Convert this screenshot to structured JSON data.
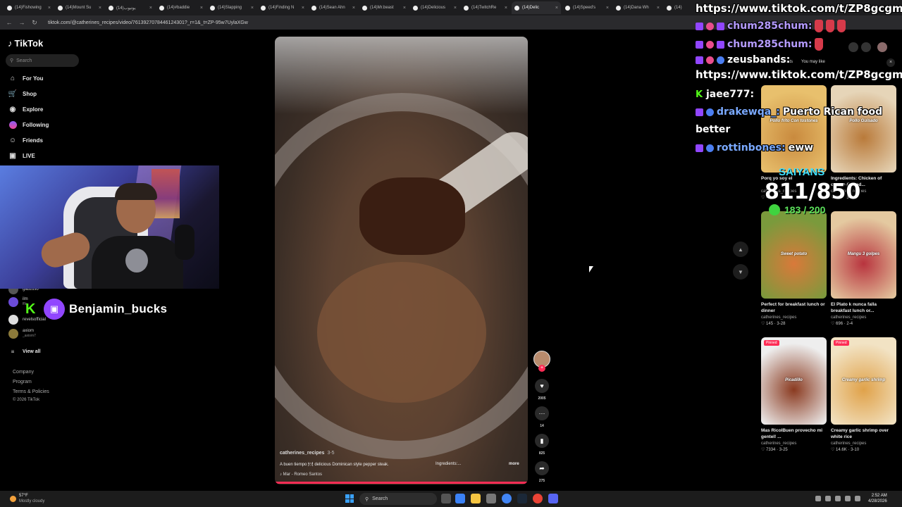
{
  "browser": {
    "tabs": [
      {
        "label": "(14)Fishowing",
        "active": false
      },
      {
        "label": "(14)Mount Su",
        "active": false
      },
      {
        "label": "(14)يوتيوب",
        "active": false
      },
      {
        "label": "(14)#baddie",
        "active": false
      },
      {
        "label": "(14)Slapping",
        "active": false
      },
      {
        "label": "(14)Finding N",
        "active": false
      },
      {
        "label": "(14)Sean Ahn",
        "active": false
      },
      {
        "label": "(14)Mr.beast",
        "active": false
      },
      {
        "label": "(14)Delicious",
        "active": false
      },
      {
        "label": "(14)TwitchRe",
        "active": false
      },
      {
        "label": "(14)Delic",
        "active": true
      },
      {
        "label": "(14)Speed's",
        "active": false
      },
      {
        "label": "(14)Dana Wh",
        "active": false
      },
      {
        "label": "(14)",
        "active": false
      }
    ],
    "url": "tiktok.com/@catherines_recipes/video/7613927078446124301?_r=1&_t=ZP-95w7UylaXGw"
  },
  "sidebar": {
    "logo": "TikTok",
    "search_placeholder": "Search",
    "nav": [
      {
        "label": "For You",
        "icon": "home-icon",
        "active": false
      },
      {
        "label": "Shop",
        "icon": "shop-icon",
        "active": false
      },
      {
        "label": "Explore",
        "icon": "compass-icon",
        "active": false
      },
      {
        "label": "Following",
        "icon": "following-icon",
        "active": false
      },
      {
        "label": "Friends",
        "icon": "friends-icon",
        "active": false
      },
      {
        "label": "LIVE",
        "icon": "live-icon",
        "active": false
      }
    ],
    "following": [
      {
        "name": "gabzuso",
        "handle": ""
      },
      {
        "name": "ilm",
        "handle": "fflo"
      },
      {
        "name": "revelsofficial",
        "handle": ""
      },
      {
        "name": "axiom",
        "handle": "_axiom7"
      }
    ],
    "view_all": "View all",
    "footer": [
      "Company",
      "Program",
      "Terms & Policies",
      "© 2026 TikTok"
    ]
  },
  "streamer": {
    "name": "Benjamin_bucks"
  },
  "video": {
    "author": "catherines_recipes",
    "date": "3-5",
    "description": "A buen tiempo 🍽 delicious Dominican style pepper steak.",
    "ingredients": "Ingredients:...",
    "more": "more",
    "music": "Mar - Romeo Santos",
    "likes": "2005",
    "comments": "14",
    "saves": "825",
    "shares": "275"
  },
  "recommendations": {
    "tabs": [
      "Comments",
      "You may like"
    ],
    "items": [
      {
        "caption": "Pollo frito Con tostones",
        "title": "Porq yo soy el",
        "author": "catherines_recipes",
        "likes": "",
        "date": "4-13",
        "pinned": false,
        "colors": [
          "#c98a3e",
          "#e8c06d"
        ]
      },
      {
        "caption": "Pollo Guisado",
        "title": "Ingredients: Chicken of choice (I used...",
        "author": "catherines_recipes",
        "likes": "320",
        "date": "3-1",
        "pinned": false,
        "colors": [
          "#b97a3a",
          "#e6d5b8"
        ]
      },
      {
        "caption": "Sweet potato",
        "title": "Perfect for breakfast lunch or dinner",
        "author": "catherines_recipes",
        "likes": "145",
        "date": "3-28",
        "pinned": false,
        "colors": [
          "#d9793a",
          "#7a9a3c"
        ]
      },
      {
        "caption": "Mangu 3 golpes",
        "title": "El Plato k nunca falla breakfast lunch or...",
        "author": "catherines_recipes",
        "likes": "696",
        "date": "2-4",
        "pinned": false,
        "colors": [
          "#b8343e",
          "#e4c9a0"
        ]
      },
      {
        "caption": "Picadillo",
        "title": "Mas RicolBuen provecho mi gentel! ...",
        "author": "catherines_recipes",
        "likes": "7334",
        "date": "3-25",
        "pinned": true,
        "colors": [
          "#8a3a20",
          "#eeeeee"
        ]
      },
      {
        "caption": "Creamy garlic shrimp",
        "title": "Creamy garlic shrimp over white rice",
        "author": "catherines_recipes",
        "likes": "14.6K",
        "date": "3-10",
        "pinned": true,
        "colors": [
          "#e0a24a",
          "#f2e3c4"
        ]
      }
    ],
    "pinned_label": "Pinned"
  },
  "chat": [
    {
      "user": "",
      "text": "https://www.tiktok.com/t/ZP8gcgmqo/",
      "color": "#ffffff"
    },
    {
      "user": "chum285chum:",
      "text": "",
      "color": "#b59bff"
    },
    {
      "user": "chum285chum:",
      "text": "",
      "color": "#b59bff"
    },
    {
      "user": "zeusbands:",
      "text": "",
      "color": "#ffffff"
    },
    {
      "user": "",
      "text": "https://www.tiktok.com/t/ZP8gcgmqo/",
      "color": "#ffffff"
    },
    {
      "user": "jaee777:",
      "text": "",
      "color": "#9bff6a"
    },
    {
      "user": "drakewqa_:",
      "text": "Puerto Rican food",
      "color": "#7aa9ff"
    },
    {
      "user": "",
      "text": "better",
      "color": "#ffffff"
    },
    {
      "user": "rottinbones:",
      "text": "eww",
      "color": "#7aa9ff"
    }
  ],
  "goals": {
    "label": "SAIYANS",
    "main": "811/850",
    "sub": "183 / 200"
  },
  "taskbar": {
    "temp": "57°F",
    "weather": "Mostly cloudy",
    "search": "Search",
    "time": "2:52 AM",
    "date": "4/28/2026"
  }
}
